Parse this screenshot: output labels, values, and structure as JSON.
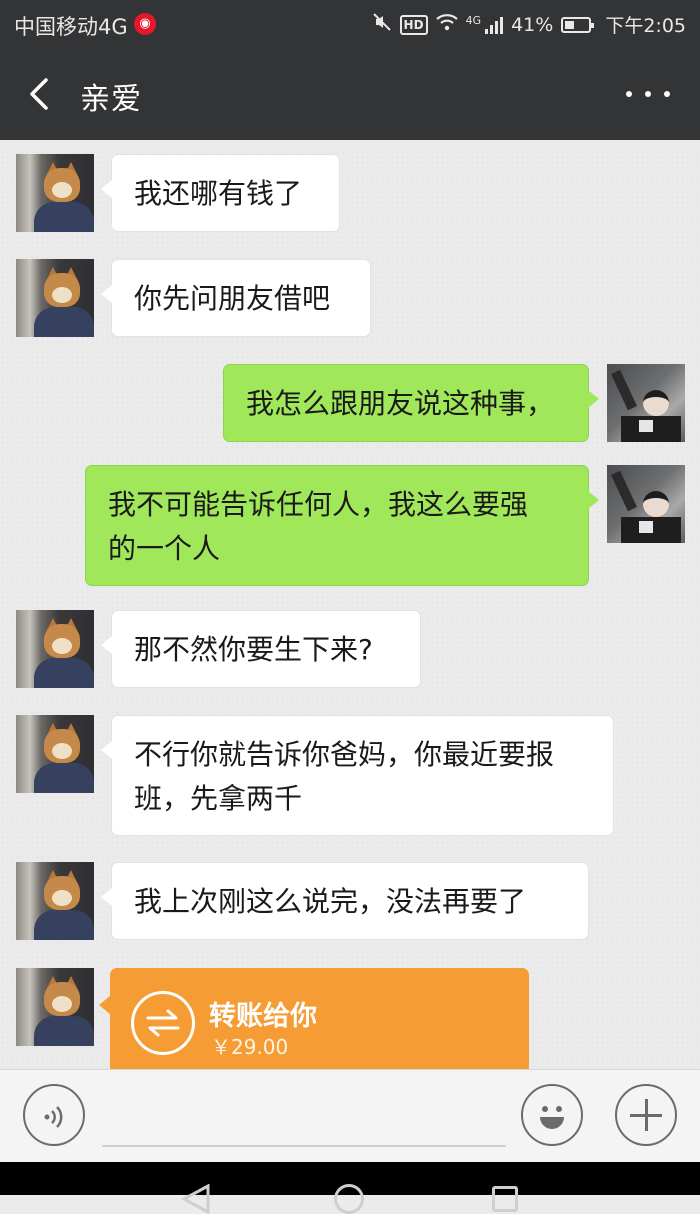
{
  "status_bar": {
    "carrier": "中国移动4G",
    "network": "4G",
    "battery": "41%",
    "battery_level": 0.41,
    "time": "下午2:05",
    "icons": [
      "weibo-notification-icon",
      "mute-icon",
      "hd-icon",
      "wifi-icon",
      "signal-icon",
      "battery-icon"
    ]
  },
  "header": {
    "title": "亲爱",
    "back_icon": "back-chevron-icon",
    "more_icon": "more-dots-icon"
  },
  "messages": [
    {
      "sender": "other",
      "lines": [
        "我还哪有钱了"
      ]
    },
    {
      "sender": "other",
      "lines": [
        "你先问朋友借吧"
      ]
    },
    {
      "sender": "me",
      "lines": [
        "我怎么跟朋友说这种事，"
      ]
    },
    {
      "sender": "me",
      "lines": [
        "我不可能告诉任何人，我这么要强",
        "的一个人"
      ]
    },
    {
      "sender": "other",
      "lines": [
        "那不然你要生下来?"
      ]
    },
    {
      "sender": "other",
      "lines": [
        "不行你就告诉你爸妈，你最近要报",
        "班，先拿两千"
      ]
    },
    {
      "sender": "other",
      "lines": [
        "我上次刚这么说完，没法再要了"
      ]
    }
  ],
  "transfer": {
    "title": "转账给你",
    "amount": "￥29.00"
  },
  "input_bar": {
    "voice_icon": "voice-icon",
    "emoji_icon": "emoji-icon",
    "plus_icon": "plus-icon"
  },
  "colors": {
    "title_bar": "#333435",
    "chat_background": "#ebebeb",
    "outgoing_bubble": "#a0e75a",
    "incoming_bubble": "#ffffff",
    "transfer_card": "#f69c34"
  }
}
